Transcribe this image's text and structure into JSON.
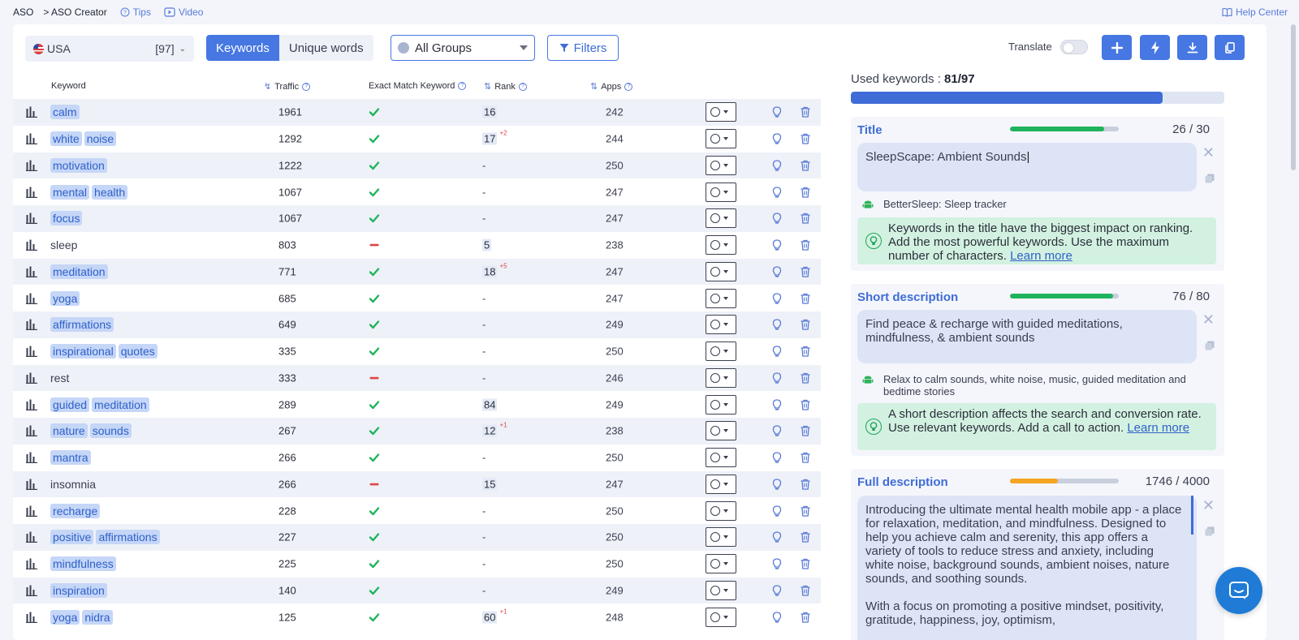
{
  "breadcrumb": {
    "root": "ASO",
    "current": "> ASO Creator"
  },
  "links": {
    "tips": "Tips",
    "video": "Video",
    "help": "Help Center"
  },
  "toolbar": {
    "country": "USA",
    "count": "[97]",
    "tab_keywords": "Keywords",
    "tab_unique": "Unique words",
    "groups": "All Groups",
    "filters": "Filters",
    "translate": "Translate"
  },
  "table": {
    "headers": {
      "keyword": "Keyword",
      "traffic": "Traffic",
      "exact": "Exact Match Keyword",
      "rank": "Rank",
      "apps": "Apps"
    },
    "rows": [
      {
        "words": [
          "calm"
        ],
        "highlight": true,
        "traffic": "1961",
        "exact": "check",
        "rank": "16",
        "delta": "",
        "apps": "242"
      },
      {
        "words": [
          "white",
          "noise"
        ],
        "highlight": true,
        "traffic": "1292",
        "exact": "check",
        "rank": "17",
        "delta": "+2",
        "apps": "244"
      },
      {
        "words": [
          "motivation"
        ],
        "highlight": true,
        "traffic": "1222",
        "exact": "check",
        "rank": "-",
        "delta": "",
        "apps": "250"
      },
      {
        "words": [
          "mental",
          "health"
        ],
        "highlight": true,
        "traffic": "1067",
        "exact": "check",
        "rank": "-",
        "delta": "",
        "apps": "247"
      },
      {
        "words": [
          "focus"
        ],
        "highlight": true,
        "traffic": "1067",
        "exact": "check",
        "rank": "-",
        "delta": "",
        "apps": "247"
      },
      {
        "words": [
          "sleep"
        ],
        "highlight": false,
        "traffic": "803",
        "exact": "minus",
        "rank": "5",
        "delta": "",
        "apps": "238"
      },
      {
        "words": [
          "meditation"
        ],
        "highlight": true,
        "traffic": "771",
        "exact": "check",
        "rank": "18",
        "delta": "+5",
        "apps": "247"
      },
      {
        "words": [
          "yoga"
        ],
        "highlight": true,
        "traffic": "685",
        "exact": "check",
        "rank": "-",
        "delta": "",
        "apps": "247"
      },
      {
        "words": [
          "affirmations"
        ],
        "highlight": true,
        "traffic": "649",
        "exact": "check",
        "rank": "-",
        "delta": "",
        "apps": "249"
      },
      {
        "words": [
          "inspirational",
          "quotes"
        ],
        "highlight": true,
        "traffic": "335",
        "exact": "check",
        "rank": "-",
        "delta": "",
        "apps": "250"
      },
      {
        "words": [
          "rest"
        ],
        "highlight": false,
        "traffic": "333",
        "exact": "minus",
        "rank": "-",
        "delta": "",
        "apps": "246"
      },
      {
        "words": [
          "guided",
          "meditation"
        ],
        "highlight": true,
        "traffic": "289",
        "exact": "check",
        "rank": "84",
        "delta": "",
        "apps": "249"
      },
      {
        "words": [
          "nature",
          "sounds"
        ],
        "highlight": true,
        "traffic": "267",
        "exact": "check",
        "rank": "12",
        "delta": "+1",
        "apps": "238"
      },
      {
        "words": [
          "mantra"
        ],
        "highlight": true,
        "traffic": "266",
        "exact": "check",
        "rank": "-",
        "delta": "",
        "apps": "250"
      },
      {
        "words": [
          "insomnia"
        ],
        "highlight": false,
        "traffic": "266",
        "exact": "minus",
        "rank": "15",
        "delta": "",
        "apps": "247"
      },
      {
        "words": [
          "recharge"
        ],
        "highlight": true,
        "traffic": "228",
        "exact": "check",
        "rank": "-",
        "delta": "",
        "apps": "250"
      },
      {
        "words": [
          "positive",
          "affirmations"
        ],
        "highlight": true,
        "traffic": "227",
        "exact": "check",
        "rank": "-",
        "delta": "",
        "apps": "250"
      },
      {
        "words": [
          "mindfulness"
        ],
        "highlight": true,
        "traffic": "225",
        "exact": "check",
        "rank": "-",
        "delta": "",
        "apps": "250"
      },
      {
        "words": [
          "inspiration"
        ],
        "highlight": true,
        "traffic": "140",
        "exact": "check",
        "rank": "-",
        "delta": "",
        "apps": "249"
      },
      {
        "words": [
          "yoga",
          "nidra"
        ],
        "highlight": true,
        "traffic": "125",
        "exact": "check",
        "rank": "60",
        "delta": "+1",
        "apps": "248"
      }
    ]
  },
  "used": {
    "label": "Used keywords : ",
    "value": "81/97",
    "fraction": 0.835
  },
  "title_section": {
    "label": "Title",
    "count": "26 / 30",
    "fraction": 0.867,
    "value": "SleepScape: Ambient Sounds",
    "competitor": "BetterSleep: Sleep tracker",
    "tip": "Keywords in the title have the biggest impact on ranking. Add the most powerful keywords. Use the maximum number of characters.",
    "learn_more": "Learn more"
  },
  "short_section": {
    "label": "Short description",
    "count": "76 / 80",
    "fraction": 0.95,
    "value": "Find peace & recharge with guided meditations, mindfulness, & ambient sounds",
    "competitor": "Relax to calm sounds, white noise, music, guided meditation and bedtime stories",
    "tip": "A short description affects the search and conversion rate. Use relevant keywords. Add a call to action.",
    "learn_more": "Learn more"
  },
  "full_section": {
    "label": "Full description",
    "count": "1746 / 4000",
    "fraction": 0.437,
    "para1": "Introducing the ultimate mental health mobile app - a place for relaxation, meditation, and mindfulness. Designed to help you achieve calm and serenity, this app offers a variety of tools to reduce stress and anxiety, including white noise, background sounds, ambient noises, nature sounds, and soothing sounds.",
    "para2": "With a focus on promoting a positive mindset, positivity, gratitude, happiness, joy, optimism,"
  },
  "colors": {
    "accent": "#4677e2",
    "good": "#1fb45c",
    "warn": "#f5a623",
    "bad": "#e04545"
  }
}
